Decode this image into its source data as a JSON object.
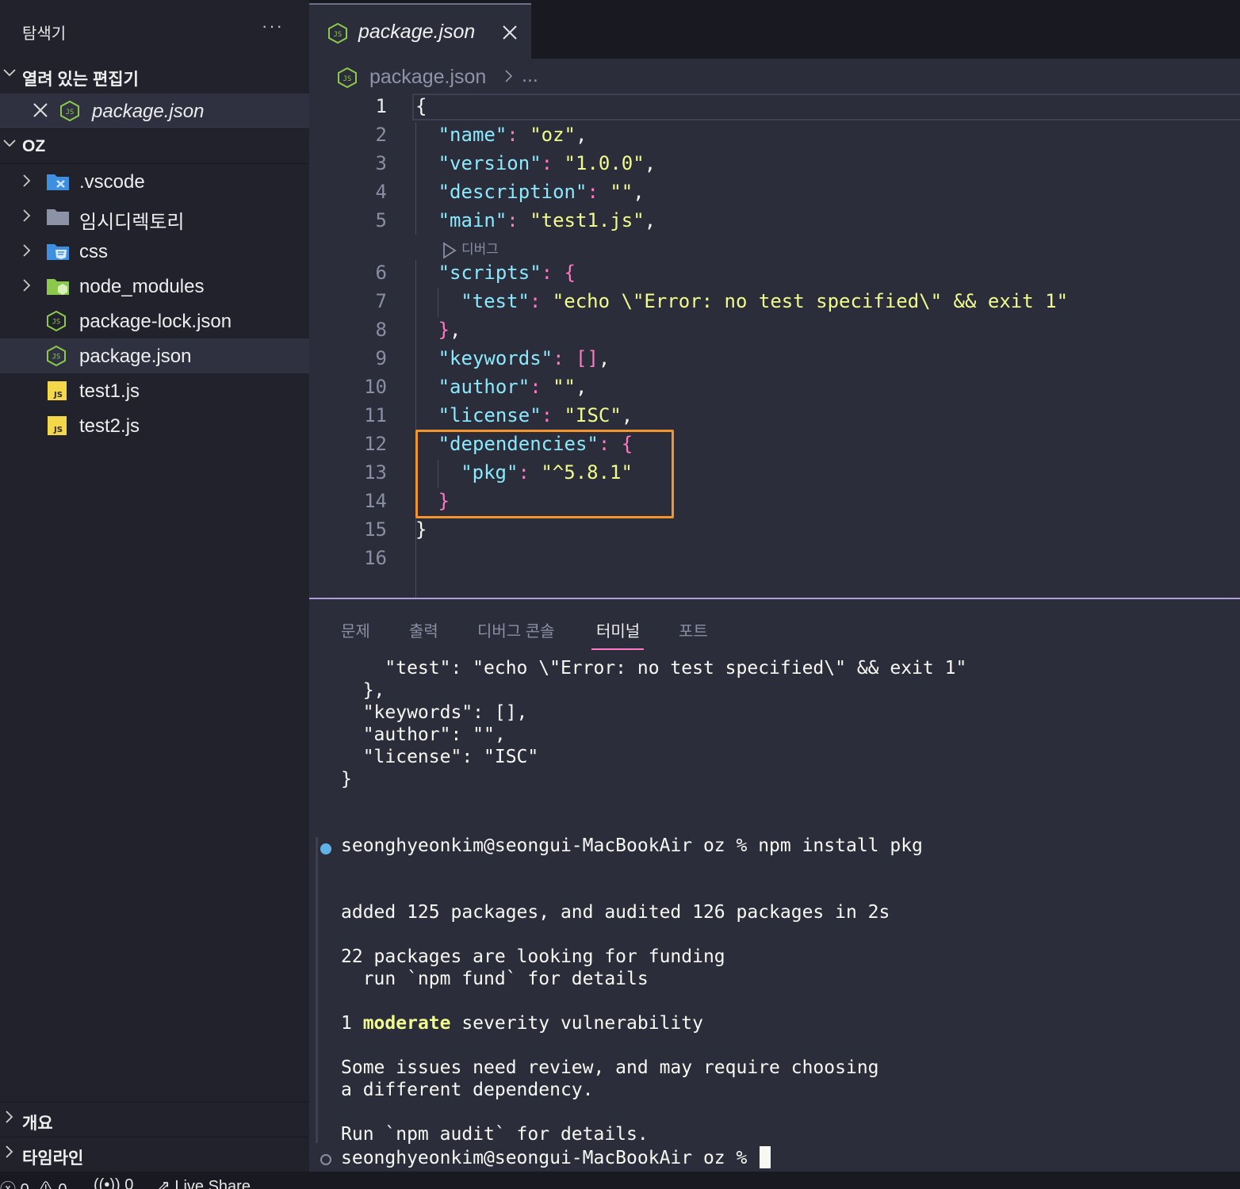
{
  "sidebar": {
    "title": "탐색기",
    "more": "···",
    "open_editors": {
      "label": "열려 있는 편집기",
      "items": [
        {
          "name": "package.json"
        }
      ]
    },
    "folder": {
      "label": "OZ",
      "items": [
        {
          "name": ".vscode",
          "kind": "folder",
          "icon": "vscode-folder-icon"
        },
        {
          "name": "임시디렉토리",
          "kind": "folder",
          "icon": "folder-icon"
        },
        {
          "name": "css",
          "kind": "folder",
          "icon": "css-folder-icon"
        },
        {
          "name": "node_modules",
          "kind": "folder",
          "icon": "node-folder-icon"
        },
        {
          "name": "package-lock.json",
          "kind": "file",
          "icon": "nodejs-file-icon"
        },
        {
          "name": "package.json",
          "kind": "file",
          "icon": "nodejs-file-icon",
          "selected": true
        },
        {
          "name": "test1.js",
          "kind": "file",
          "icon": "js-file-icon"
        },
        {
          "name": "test2.js",
          "kind": "file",
          "icon": "js-file-icon"
        }
      ]
    },
    "outline_label": "개요",
    "timeline_label": "타임라인"
  },
  "editor": {
    "tab_label": "package.json",
    "breadcrumb": {
      "file": "package.json",
      "more": "..."
    },
    "codelens": "디버그",
    "current_line": 1,
    "lines": [
      {
        "n": "1",
        "text": "{"
      },
      {
        "n": "2",
        "text": "\"name\": \"oz\","
      },
      {
        "n": "3",
        "text": "\"version\": \"1.0.0\","
      },
      {
        "n": "4",
        "text": "\"description\": \"\","
      },
      {
        "n": "5",
        "text": "\"main\": \"test1.js\","
      },
      {
        "n": "6",
        "text": "\"scripts\": {"
      },
      {
        "n": "7",
        "text": "\"test\": \"echo \\\"Error: no test specified\\\" && exit 1\""
      },
      {
        "n": "8",
        "text": "},"
      },
      {
        "n": "9",
        "text": "\"keywords\": [],"
      },
      {
        "n": "10",
        "text": "\"author\": \"\","
      },
      {
        "n": "11",
        "text": "\"license\": \"ISC\","
      },
      {
        "n": "12",
        "text": "\"dependencies\": {"
      },
      {
        "n": "13",
        "text": "\"pkg\": \"^5.8.1\""
      },
      {
        "n": "14",
        "text": "}"
      },
      {
        "n": "15",
        "text": "}"
      },
      {
        "n": "16",
        "text": ""
      }
    ]
  },
  "panel": {
    "tabs": [
      {
        "label": "문제"
      },
      {
        "label": "출력"
      },
      {
        "label": "디버그 콘솔"
      },
      {
        "label": "터미널",
        "active": true
      },
      {
        "label": "포트"
      }
    ],
    "terminal_lines": [
      "    \"test\": \"echo \\\"Error: no test specified\\\" && exit 1\"",
      "  },",
      "  \"keywords\": [],",
      "  \"author\": \"\",",
      "  \"license\": \"ISC\"",
      "}",
      "seonghyeonkim@seongui-MacBookAir oz % npm install pkg",
      "added 125 packages, and audited 126 packages in 2s",
      "22 packages are looking for funding",
      "  run `npm fund` for details",
      "1 ",
      "moderate",
      " severity vulnerability",
      "Some issues need review, and may require choosing",
      "a different dependency.",
      "Run `npm audit` for details.",
      "seonghyeonkim@seongui-MacBookAir oz % "
    ]
  },
  "status": {
    "errors": "0",
    "warnings": "0",
    "ports": "0",
    "live_share": "Live Share"
  },
  "colors": {
    "key": "#8be9fd",
    "string": "#f1fa8c",
    "punct": "#ff79c6",
    "highlight_box": "#f3952b",
    "active_tab_underline": "#ff79c6"
  }
}
